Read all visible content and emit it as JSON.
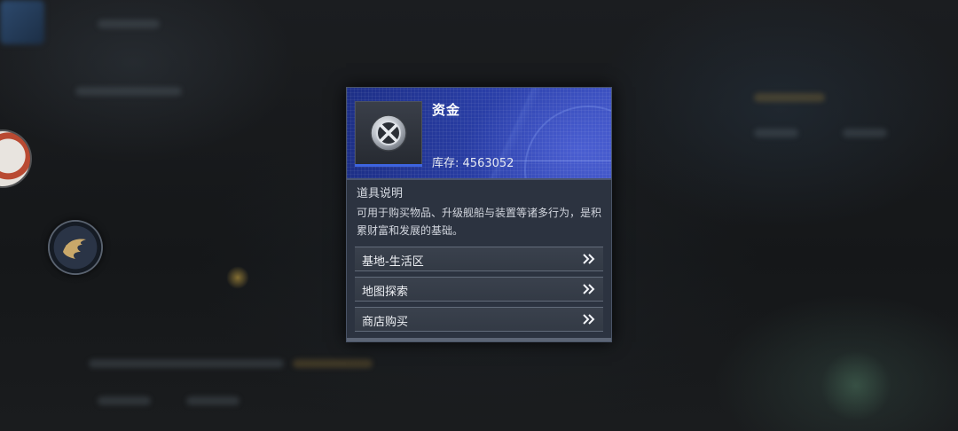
{
  "item": {
    "name": "资金",
    "stock_label": "库存:",
    "stock_value": "4563052",
    "icon": "coin-currency-icon"
  },
  "description": {
    "title": "道具说明",
    "text": "可用于购买物品、升级舰船与装置等诸多行为，是积累财富和发展的基础。"
  },
  "sources": [
    {
      "label": "基地-生活区",
      "icon": "double-chevron-right-icon"
    },
    {
      "label": "地图探索",
      "icon": "double-chevron-right-icon"
    },
    {
      "label": "商店购买",
      "icon": "double-chevron-right-icon"
    }
  ],
  "colors": {
    "header_blue": "#2a3fa8",
    "panel_bg": "#2c3340",
    "accent_blue": "#3d64e0"
  }
}
